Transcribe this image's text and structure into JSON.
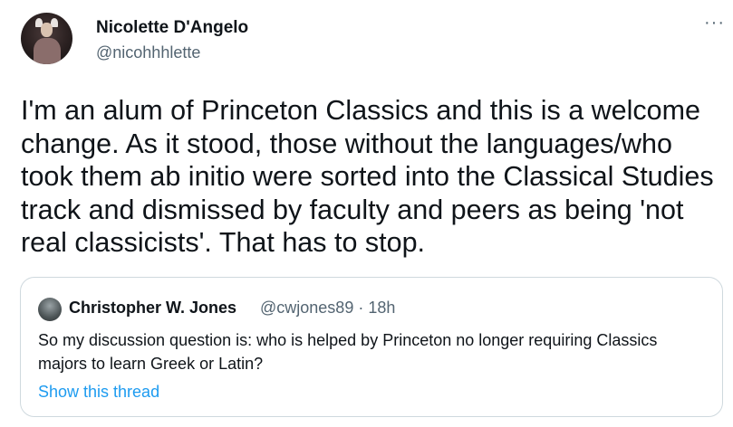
{
  "author": {
    "name": "Nicolette D'Angelo",
    "handle": "@nicohhhlette",
    "avatar_icon": "profile-photo-icon"
  },
  "more_icon": "···",
  "tweet_text": "I'm an alum of Princeton Classics and this is a welcome change. As it stood, those without the languages/who took them ab initio were sorted into the Classical Studies track and dismissed by faculty and peers as being 'not real classicists'. That has to stop.",
  "quoted": {
    "name": "Christopher W. Jones",
    "meta": "@cwjones89 · 18h",
    "text": "So my discussion question is: who is helped by Princeton no longer requiring Classics majors to learn Greek or Latin?",
    "link": "Show this thread"
  },
  "colors": {
    "text": "#0f1419",
    "secondary": "#536471",
    "accent": "#1d9bf0",
    "border": "#cfd9de"
  }
}
